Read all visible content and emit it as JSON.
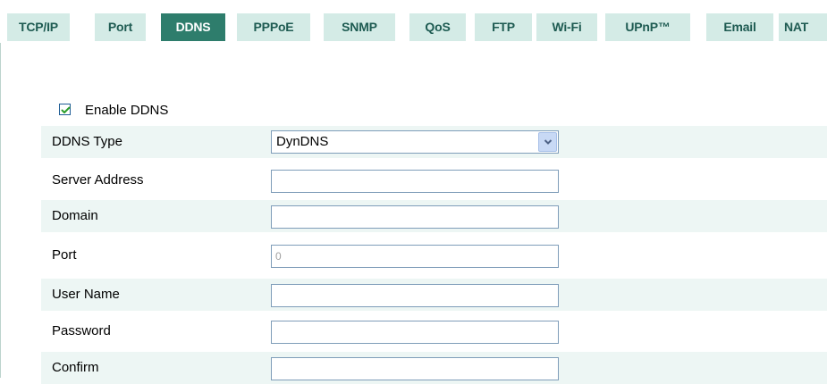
{
  "tabs": [
    {
      "label": "TCP/IP",
      "active": false
    },
    {
      "label": "Port",
      "active": false
    },
    {
      "label": "DDNS",
      "active": true
    },
    {
      "label": "PPPoE",
      "active": false
    },
    {
      "label": "SNMP",
      "active": false
    },
    {
      "label": "QoS",
      "active": false
    },
    {
      "label": "FTP",
      "active": false
    },
    {
      "label": "Wi-Fi",
      "active": false
    },
    {
      "label": "UPnP™",
      "active": false
    },
    {
      "label": "Email",
      "active": false
    },
    {
      "label": "NAT",
      "active": false
    }
  ],
  "enable_ddns": {
    "label": "Enable DDNS",
    "checked": true,
    "icon": "checkmark-icon"
  },
  "form": {
    "ddns_type": {
      "label": "DDNS Type",
      "value": "DynDNS",
      "icon": "chevron-down-icon"
    },
    "server_address": {
      "label": "Server Address",
      "value": ""
    },
    "domain": {
      "label": "Domain",
      "value": ""
    },
    "port": {
      "label": "Port",
      "value": "0",
      "disabled": true
    },
    "user_name": {
      "label": "User Name",
      "value": ""
    },
    "password": {
      "label": "Password",
      "value": ""
    },
    "confirm": {
      "label": "Confirm",
      "value": ""
    }
  },
  "colors": {
    "tab_background": "#d4ebe6",
    "tab_text": "#1e5b52",
    "tab_active_background": "#2e7d6c",
    "tab_active_text": "#ffffff",
    "row_shade": "#edf6f4",
    "field_border": "#7f9db9",
    "checkmark": "#2a9d2a"
  }
}
